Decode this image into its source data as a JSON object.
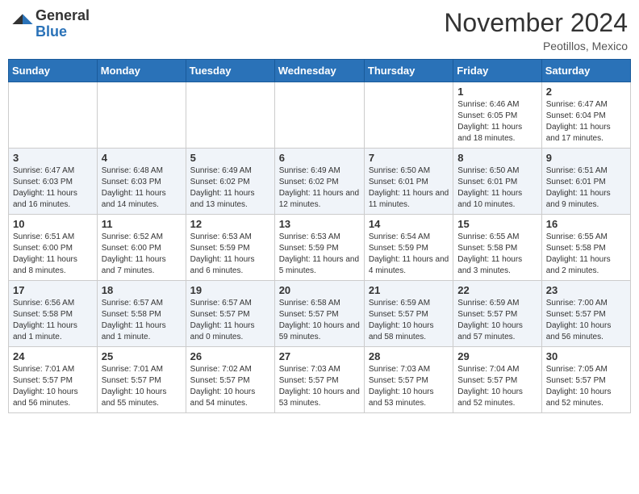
{
  "header": {
    "logo_general": "General",
    "logo_blue": "Blue",
    "month_title": "November 2024",
    "location": "Peotillos, Mexico"
  },
  "weekdays": [
    "Sunday",
    "Monday",
    "Tuesday",
    "Wednesday",
    "Thursday",
    "Friday",
    "Saturday"
  ],
  "weeks": [
    [
      {
        "day": "",
        "info": ""
      },
      {
        "day": "",
        "info": ""
      },
      {
        "day": "",
        "info": ""
      },
      {
        "day": "",
        "info": ""
      },
      {
        "day": "",
        "info": ""
      },
      {
        "day": "1",
        "info": "Sunrise: 6:46 AM\nSunset: 6:05 PM\nDaylight: 11 hours and 18 minutes."
      },
      {
        "day": "2",
        "info": "Sunrise: 6:47 AM\nSunset: 6:04 PM\nDaylight: 11 hours and 17 minutes."
      }
    ],
    [
      {
        "day": "3",
        "info": "Sunrise: 6:47 AM\nSunset: 6:03 PM\nDaylight: 11 hours and 16 minutes."
      },
      {
        "day": "4",
        "info": "Sunrise: 6:48 AM\nSunset: 6:03 PM\nDaylight: 11 hours and 14 minutes."
      },
      {
        "day": "5",
        "info": "Sunrise: 6:49 AM\nSunset: 6:02 PM\nDaylight: 11 hours and 13 minutes."
      },
      {
        "day": "6",
        "info": "Sunrise: 6:49 AM\nSunset: 6:02 PM\nDaylight: 11 hours and 12 minutes."
      },
      {
        "day": "7",
        "info": "Sunrise: 6:50 AM\nSunset: 6:01 PM\nDaylight: 11 hours and 11 minutes."
      },
      {
        "day": "8",
        "info": "Sunrise: 6:50 AM\nSunset: 6:01 PM\nDaylight: 11 hours and 10 minutes."
      },
      {
        "day": "9",
        "info": "Sunrise: 6:51 AM\nSunset: 6:01 PM\nDaylight: 11 hours and 9 minutes."
      }
    ],
    [
      {
        "day": "10",
        "info": "Sunrise: 6:51 AM\nSunset: 6:00 PM\nDaylight: 11 hours and 8 minutes."
      },
      {
        "day": "11",
        "info": "Sunrise: 6:52 AM\nSunset: 6:00 PM\nDaylight: 11 hours and 7 minutes."
      },
      {
        "day": "12",
        "info": "Sunrise: 6:53 AM\nSunset: 5:59 PM\nDaylight: 11 hours and 6 minutes."
      },
      {
        "day": "13",
        "info": "Sunrise: 6:53 AM\nSunset: 5:59 PM\nDaylight: 11 hours and 5 minutes."
      },
      {
        "day": "14",
        "info": "Sunrise: 6:54 AM\nSunset: 5:59 PM\nDaylight: 11 hours and 4 minutes."
      },
      {
        "day": "15",
        "info": "Sunrise: 6:55 AM\nSunset: 5:58 PM\nDaylight: 11 hours and 3 minutes."
      },
      {
        "day": "16",
        "info": "Sunrise: 6:55 AM\nSunset: 5:58 PM\nDaylight: 11 hours and 2 minutes."
      }
    ],
    [
      {
        "day": "17",
        "info": "Sunrise: 6:56 AM\nSunset: 5:58 PM\nDaylight: 11 hours and 1 minute."
      },
      {
        "day": "18",
        "info": "Sunrise: 6:57 AM\nSunset: 5:58 PM\nDaylight: 11 hours and 1 minute."
      },
      {
        "day": "19",
        "info": "Sunrise: 6:57 AM\nSunset: 5:57 PM\nDaylight: 11 hours and 0 minutes."
      },
      {
        "day": "20",
        "info": "Sunrise: 6:58 AM\nSunset: 5:57 PM\nDaylight: 10 hours and 59 minutes."
      },
      {
        "day": "21",
        "info": "Sunrise: 6:59 AM\nSunset: 5:57 PM\nDaylight: 10 hours and 58 minutes."
      },
      {
        "day": "22",
        "info": "Sunrise: 6:59 AM\nSunset: 5:57 PM\nDaylight: 10 hours and 57 minutes."
      },
      {
        "day": "23",
        "info": "Sunrise: 7:00 AM\nSunset: 5:57 PM\nDaylight: 10 hours and 56 minutes."
      }
    ],
    [
      {
        "day": "24",
        "info": "Sunrise: 7:01 AM\nSunset: 5:57 PM\nDaylight: 10 hours and 56 minutes."
      },
      {
        "day": "25",
        "info": "Sunrise: 7:01 AM\nSunset: 5:57 PM\nDaylight: 10 hours and 55 minutes."
      },
      {
        "day": "26",
        "info": "Sunrise: 7:02 AM\nSunset: 5:57 PM\nDaylight: 10 hours and 54 minutes."
      },
      {
        "day": "27",
        "info": "Sunrise: 7:03 AM\nSunset: 5:57 PM\nDaylight: 10 hours and 53 minutes."
      },
      {
        "day": "28",
        "info": "Sunrise: 7:03 AM\nSunset: 5:57 PM\nDaylight: 10 hours and 53 minutes."
      },
      {
        "day": "29",
        "info": "Sunrise: 7:04 AM\nSunset: 5:57 PM\nDaylight: 10 hours and 52 minutes."
      },
      {
        "day": "30",
        "info": "Sunrise: 7:05 AM\nSunset: 5:57 PM\nDaylight: 10 hours and 52 minutes."
      }
    ]
  ]
}
